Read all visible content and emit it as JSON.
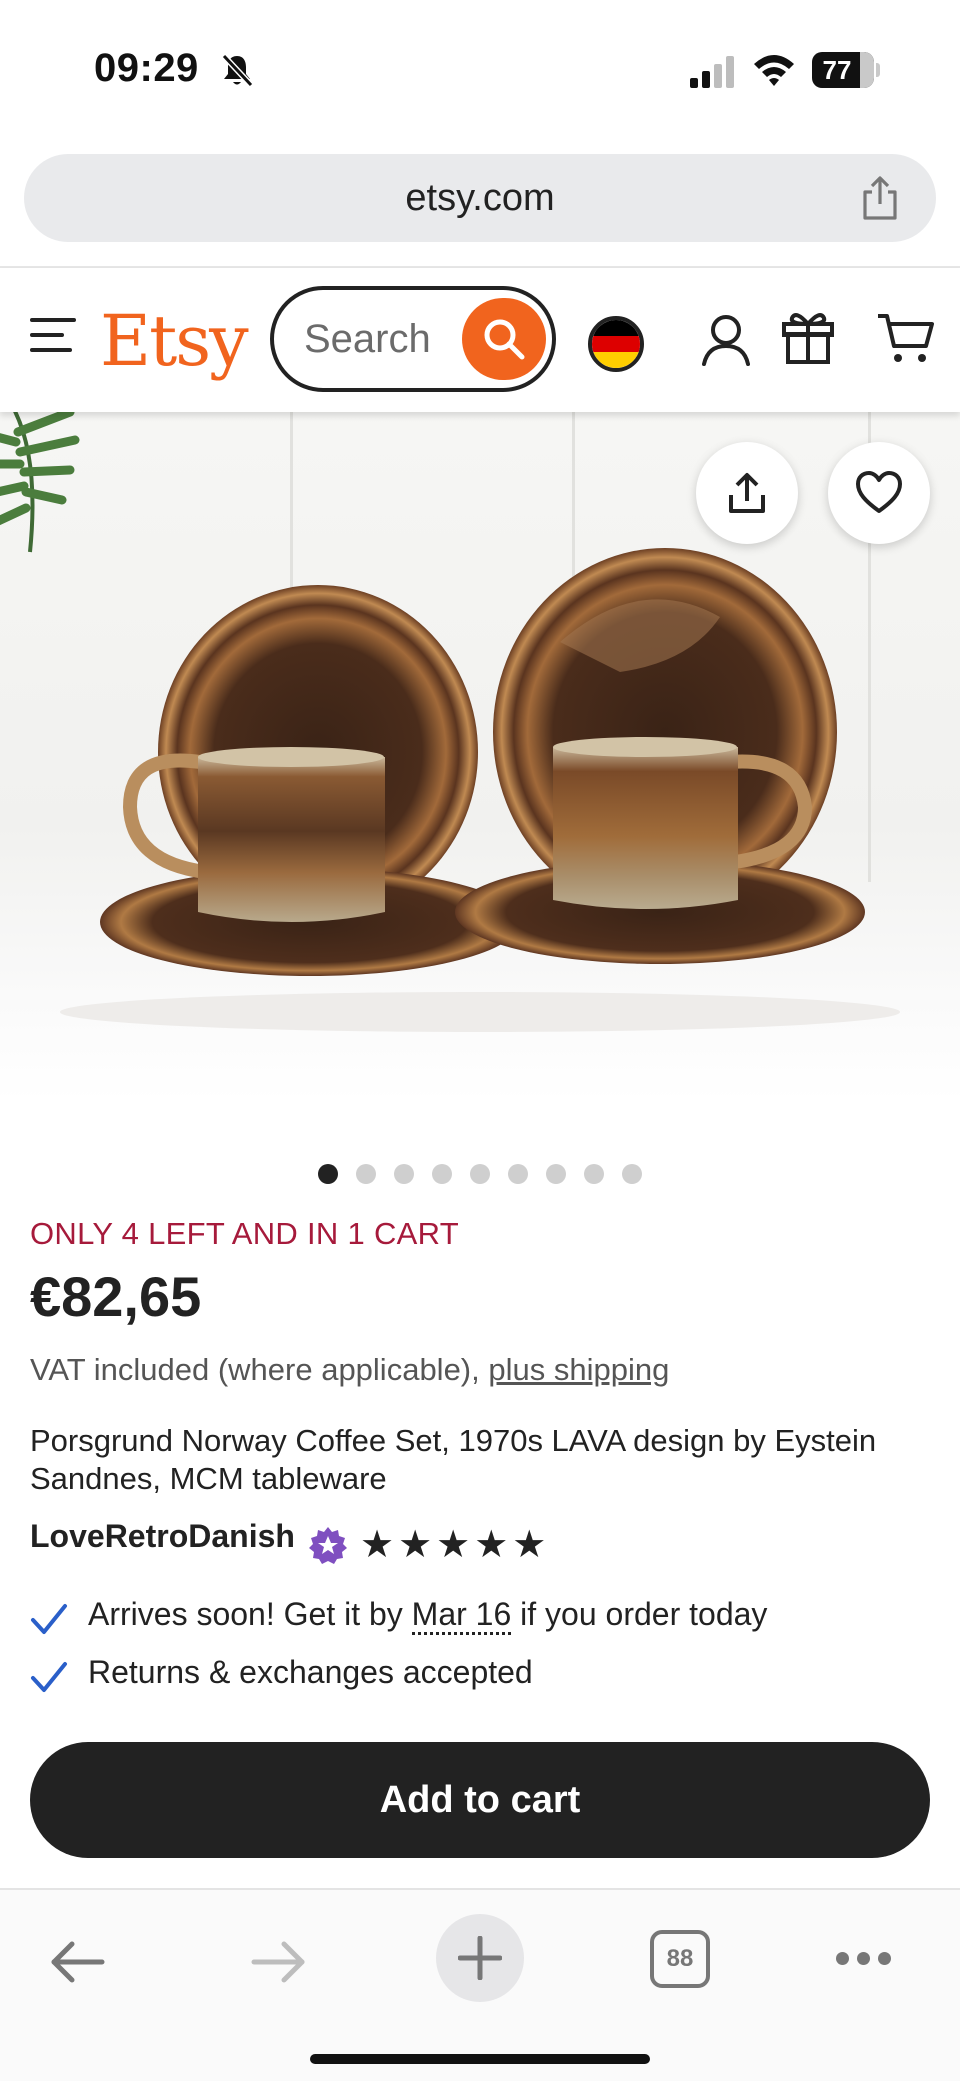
{
  "status_bar": {
    "time": "09:29",
    "battery": "77",
    "battery_level": 0.77
  },
  "browser": {
    "url": "etsy.com",
    "tabs_count": "88"
  },
  "header": {
    "logo": "Etsy",
    "search_placeholder": "Search"
  },
  "gallery": {
    "dot_count": 9,
    "active_index": 0
  },
  "product": {
    "stock_note": "ONLY 4 LEFT AND IN 1 CART",
    "price": "€82,65",
    "vat_text": "VAT included (where applicable), ",
    "shipping_link": "plus shipping",
    "title": "Porsgrund Norway Coffee Set, 1970s LAVA design by Eystein Sandnes, MCM tableware",
    "shop_name": "LoveRetroDanish",
    "rating": 5,
    "stars": "★★★★★",
    "delivery_prefix": "Arrives soon! Get it by ",
    "delivery_date": "Mar 16",
    "delivery_suffix": " if you order today",
    "returns": "Returns & exchanges accepted",
    "add_to_cart": "Add to cart"
  },
  "colors": {
    "brand": "#f1641e",
    "stock_note": "#a61a3b",
    "check": "#2a5fc9",
    "button": "#222222"
  }
}
